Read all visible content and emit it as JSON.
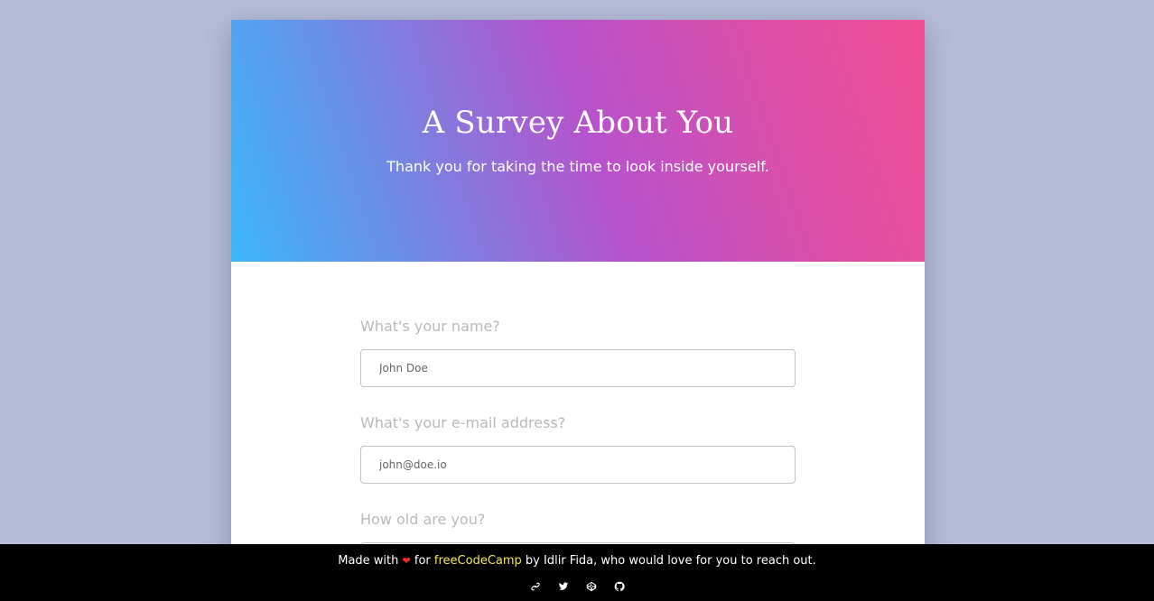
{
  "header": {
    "title": "A Survey About You",
    "subtitle": "Thank you for taking the time to look inside yourself."
  },
  "form": {
    "fields": [
      {
        "label": "What's your name?",
        "placeholder": "John Doe"
      },
      {
        "label": "What's your e-mail address?",
        "placeholder": "john@doe.io"
      },
      {
        "label": "How old are you?",
        "placeholder": ""
      }
    ]
  },
  "footer": {
    "made_with": "Made with",
    "heart": "❤",
    "for": "for",
    "fcc_link": "freeCodeCamp",
    "rest": "by Idlir Fida, who would love for you to reach out.",
    "icons": [
      "link-icon",
      "twitter-icon",
      "codepen-icon",
      "github-icon"
    ]
  },
  "colors": {
    "background": "#b5bdd8",
    "gradient_start": "#3cb7fb",
    "gradient_mid": "#b752cc",
    "gradient_end": "#f04e94",
    "link_accent": "#f5e94c",
    "heart": "#ff2a2a"
  }
}
